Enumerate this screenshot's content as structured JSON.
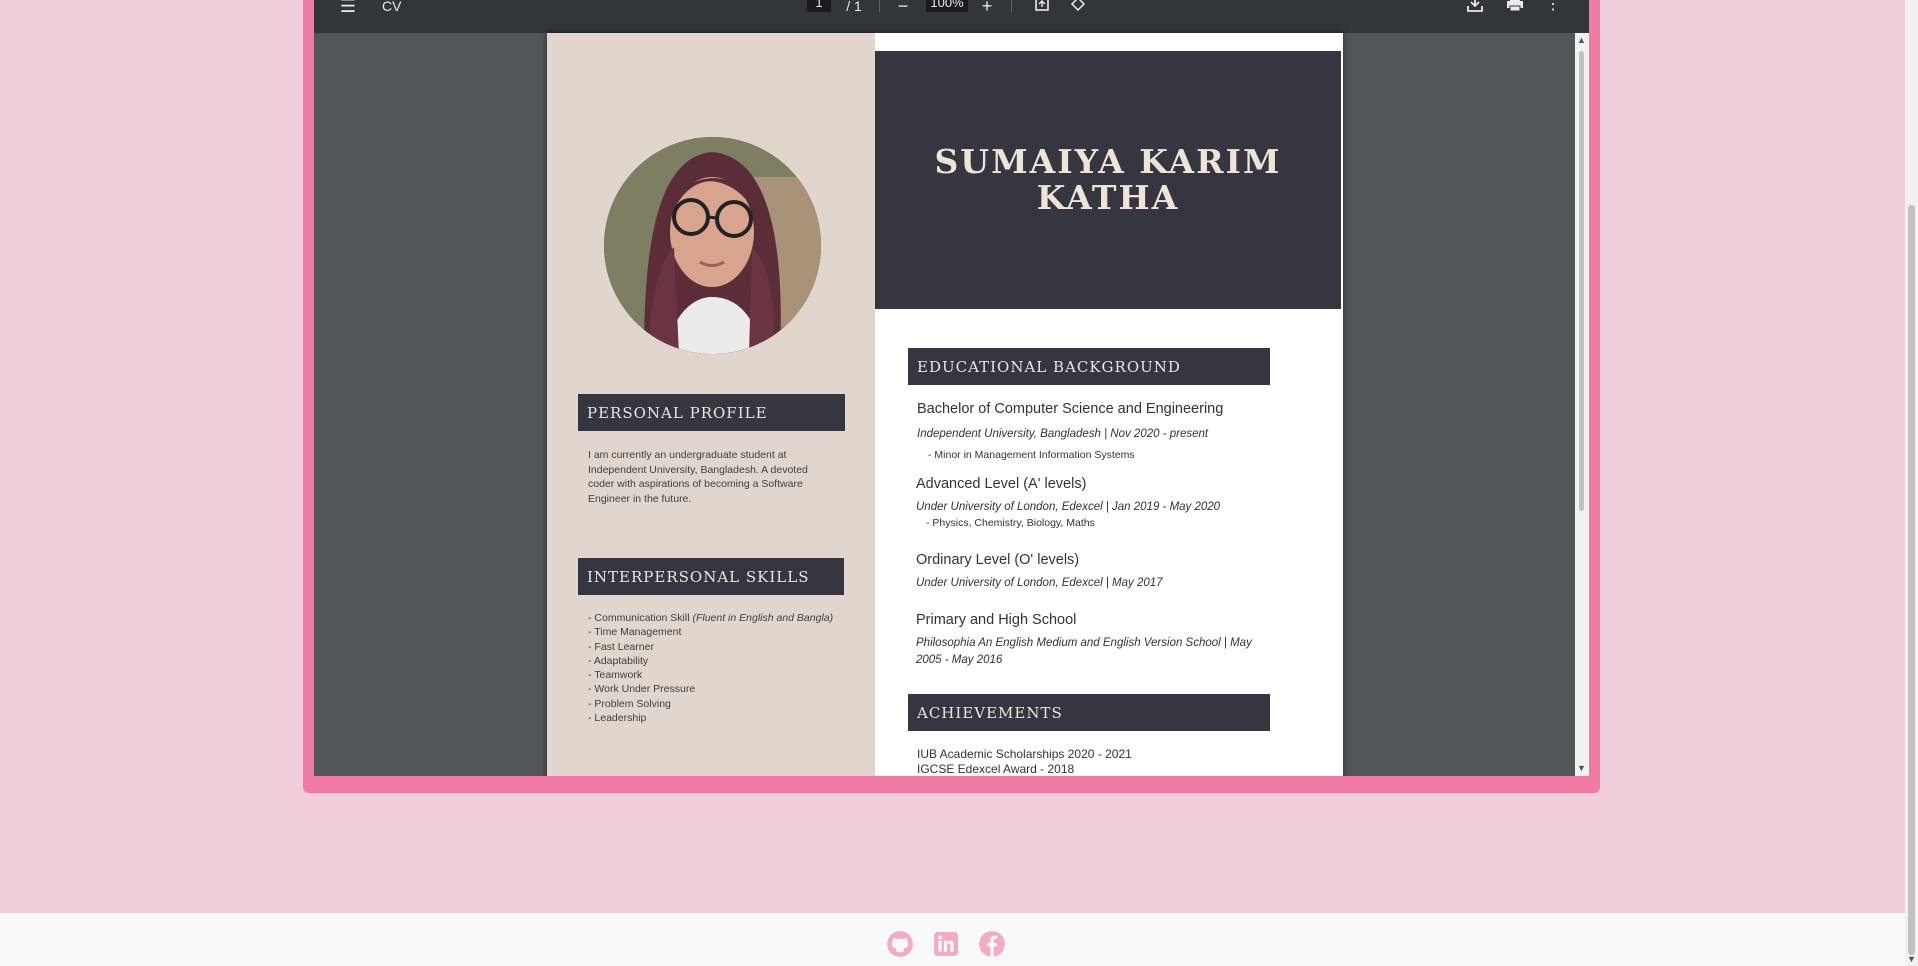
{
  "viewer": {
    "doc_title": "CV",
    "current_page": "1",
    "page_separator": "/ 1",
    "zoom": "100%",
    "zoom_out_label": "−",
    "zoom_in_label": "+",
    "menu_label": "☰",
    "more_label": "⋮"
  },
  "cv": {
    "name_line1": "SUMAIYA KARIM",
    "name_line2": "KATHA",
    "personal_profile_title": "PERSONAL PROFILE",
    "personal_profile_text": "I am currently an undergraduate student at Independent University, Bangladesh. A devoted coder with aspirations of becoming a Software Engineer in the future.",
    "skills_title": "INTERPERSONAL SKILLS",
    "skills": [
      {
        "text": "- Communication Skill ",
        "note": "(Fluent in English and Bangla)"
      },
      {
        "text": "- Time Management"
      },
      {
        "text": "- Fast Learner"
      },
      {
        "text": "- Adaptability"
      },
      {
        "text": "- Teamwork"
      },
      {
        "text": "- Work Under Pressure"
      },
      {
        "text": "- Problem Solving"
      },
      {
        "text": "- Leadership"
      }
    ],
    "education_title": "EDUCATIONAL BACKGROUND",
    "education": [
      {
        "degree": "Bachelor of Computer Science and Engineering",
        "institution": "Independent University, Bangladesh | Nov 2020 - present",
        "note": "- Minor in  Management Information Systems"
      },
      {
        "degree": "Advanced Level (A' levels)",
        "institution": "Under University of London, Edexcel | Jan 2019 - May 2020",
        "note": "- Physics, Chemistry, Biology, Maths"
      },
      {
        "degree": "Ordinary Level (O' levels)",
        "institution": "Under University of London, Edexcel | May 2017"
      },
      {
        "degree": "Primary and High School",
        "institution_line1": "Philosophia An English Medium and English Version School | May",
        "institution_line2": "2005 - May 2016"
      }
    ],
    "achievements_title": "ACHIEVEMENTS",
    "achievements": [
      "IUB Academic Scholarships 2020 - 2021",
      "IGCSE Edexcel Award - 2018"
    ]
  },
  "footer": {
    "icons": [
      "github-icon",
      "linkedin-icon",
      "facebook-icon"
    ],
    "icon_color": "#f3aac3"
  },
  "colors": {
    "page_background": "#f0cedb",
    "frame": "#f27aa6",
    "cv_dark": "#363640",
    "cv_beige": "#e0d6cd"
  }
}
